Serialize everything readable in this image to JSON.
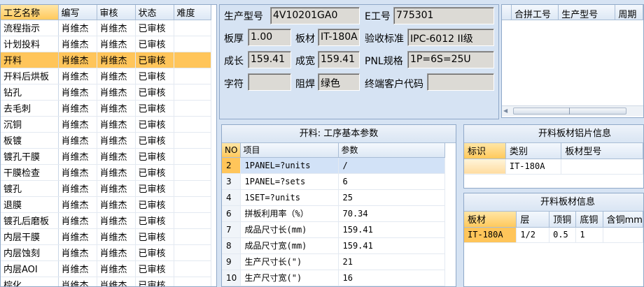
{
  "process_grid": {
    "columns": [
      "工艺名称",
      "编写",
      "审核",
      "状态",
      "难度"
    ],
    "rows": [
      {
        "name": "流程指示",
        "writer": "肖维杰",
        "reviewer": "肖维杰",
        "status": "已审核",
        "difficulty": ""
      },
      {
        "name": "计划投料",
        "writer": "肖维杰",
        "reviewer": "肖维杰",
        "status": "已审核",
        "difficulty": ""
      },
      {
        "name": "开料",
        "writer": "肖维杰",
        "reviewer": "肖维杰",
        "status": "已审核",
        "difficulty": ""
      },
      {
        "name": "开料后烘板",
        "writer": "肖维杰",
        "reviewer": "肖维杰",
        "status": "已审核",
        "difficulty": ""
      },
      {
        "name": "钻孔",
        "writer": "肖维杰",
        "reviewer": "肖维杰",
        "status": "已审核",
        "difficulty": ""
      },
      {
        "name": "去毛刺",
        "writer": "肖维杰",
        "reviewer": "肖维杰",
        "status": "已审核",
        "difficulty": ""
      },
      {
        "name": "沉铜",
        "writer": "肖维杰",
        "reviewer": "肖维杰",
        "status": "已审核",
        "difficulty": ""
      },
      {
        "name": "板镀",
        "writer": "肖维杰",
        "reviewer": "肖维杰",
        "status": "已审核",
        "difficulty": ""
      },
      {
        "name": "镀孔干膜",
        "writer": "肖维杰",
        "reviewer": "肖维杰",
        "status": "已审核",
        "difficulty": ""
      },
      {
        "name": "干膜检查",
        "writer": "肖维杰",
        "reviewer": "肖维杰",
        "status": "已审核",
        "difficulty": ""
      },
      {
        "name": "镀孔",
        "writer": "肖维杰",
        "reviewer": "肖维杰",
        "status": "已审核",
        "difficulty": ""
      },
      {
        "name": "退膜",
        "writer": "肖维杰",
        "reviewer": "肖维杰",
        "status": "已审核",
        "difficulty": ""
      },
      {
        "name": "镀孔后磨板",
        "writer": "肖维杰",
        "reviewer": "肖维杰",
        "status": "已审核",
        "difficulty": ""
      },
      {
        "name": "内层干膜",
        "writer": "肖维杰",
        "reviewer": "肖维杰",
        "status": "已审核",
        "difficulty": ""
      },
      {
        "name": "内层蚀刻",
        "writer": "肖维杰",
        "reviewer": "肖维杰",
        "status": "已审核",
        "difficulty": ""
      },
      {
        "name": "内层AOI",
        "writer": "肖维杰",
        "reviewer": "肖维杰",
        "status": "已审核",
        "difficulty": ""
      },
      {
        "name": "棕化",
        "writer": "肖维杰",
        "reviewer": "肖维杰",
        "status": "已审核",
        "difficulty": ""
      }
    ]
  },
  "info": {
    "product_model_label": "生产型号",
    "product_model": "4V10201GA0",
    "e_no_label": "E工号",
    "e_no": "775301",
    "thickness_label": "板厚",
    "thickness": "1.00",
    "material_label": "板材",
    "material": "IT-180A",
    "acceptance_label": "验收标准",
    "acceptance": "IPC-6012 II级",
    "length_label": "成长",
    "length": "159.41",
    "width_label": "成宽",
    "width": "159.41",
    "pnl_label": "PNL规格",
    "pnl": "1P=6S=25U",
    "char_label": "字符",
    "char": "",
    "mask_label": "阻焊",
    "mask": "绿色",
    "customer_label": "终端客户代码",
    "customer": ""
  },
  "combo_grid": {
    "columns": [
      "合拼工号",
      "生产型号",
      "周期"
    ]
  },
  "params": {
    "title": "开料: 工序基本参数",
    "columns": [
      "NO",
      "项目",
      "参数"
    ],
    "rows": [
      {
        "no": "2",
        "item": "1PANEL=?units",
        "value": "/"
      },
      {
        "no": "3",
        "item": "1PANEL=?sets",
        "value": "6"
      },
      {
        "no": "4",
        "item": "1SET=?units",
        "value": "25"
      },
      {
        "no": "6",
        "item": "拼板利用率（%）",
        "value": "70.34"
      },
      {
        "no": "7",
        "item": "成品尺寸长(mm)",
        "value": "159.41"
      },
      {
        "no": "8",
        "item": "成品尺寸宽(mm)",
        "value": "159.41"
      },
      {
        "no": "9",
        "item": "生产尺寸长(\")",
        "value": "21"
      },
      {
        "no": "10",
        "item": "生产尺寸宽(\")",
        "value": "16"
      }
    ]
  },
  "blade": {
    "title": "开料板材铝片信息",
    "columns": [
      "标识",
      "类别",
      "板材型号"
    ],
    "rows": [
      {
        "mark": "",
        "category": "IT-180A",
        "model": ""
      }
    ]
  },
  "material": {
    "title": "开料板材信息",
    "columns": [
      "板材",
      "层",
      "顶铜",
      "底铜",
      "含铜mm"
    ],
    "rows": [
      {
        "material": "IT-180A",
        "layer": "1/2",
        "top": "0.5",
        "bottom": "1",
        "cu": ""
      }
    ]
  }
}
